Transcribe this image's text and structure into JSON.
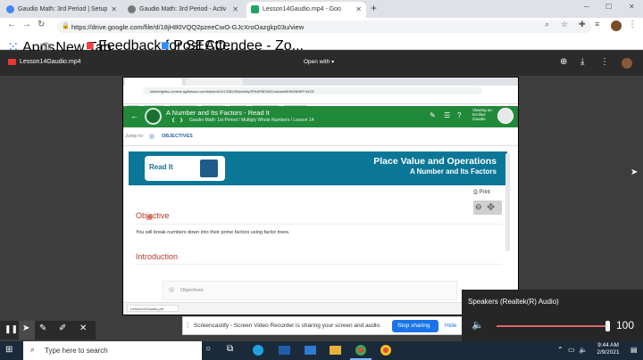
{
  "browser": {
    "tabs": [
      {
        "label": "Gaudio Math: 3rd Period | Setup",
        "color": "#4285f4",
        "active": false
      },
      {
        "label": "Gaudio Math: 3rd Period - Activ",
        "color": "#555555",
        "active": false
      },
      {
        "label": "Lesson14Gaudio.mp4 - Goo",
        "color": "#1fa463",
        "active": true
      }
    ],
    "new_tab": "+",
    "url": "https://drive.google.com/file/d/18jH80VQQ2pzeeCwO-GJcXroOazgkp03u/view",
    "bookmarks": [
      "Apps",
      "New Tab",
      "Feedback for SECO...",
      "Post Attendee - Zo..."
    ]
  },
  "drive": {
    "filename": "Lesson14Gaudio.mp4",
    "open_with": "Open with"
  },
  "lms": {
    "inner_url": "kidsheightsc-central.agilixbuzz.com/student/141338205/activity/5F6AFBD9AD1a4aba5bf9/08b6FFd4CE",
    "title": "A Number and Its Factors - Read It",
    "breadcrumb": "Gaudio Math: 1st Period / Multiply Whole Numbers / Lesson 14",
    "viewing_as": "Viewing as:\nEmiliee\nGaudio",
    "jump_to": "Jump to:",
    "objectives_link": "OBJECTIVES",
    "read_it": "Read It",
    "banner_title": "Place Value and Operations",
    "banner_subtitle": "A Number and Its Factors",
    "print": "Print",
    "objective_heading": "Objective",
    "objective_text": "You will break numbers down into their prime factors using factor trees.",
    "introduction_heading": "Introduction",
    "bottom_objectives": "Objectives",
    "download_file": "Lesson14Gaudio.pdf"
  },
  "screencastify": {
    "message": "Screencastify - Screen Video Recorder is sharing your screen and audio.",
    "stop_label": "Stop sharing",
    "hide_label": "Hide"
  },
  "speaker": {
    "device": "Speakers (Realtek(R) Audio)",
    "volume": "100",
    "volume_level": 1.0
  },
  "taskbar": {
    "search_placeholder": "Type here to search",
    "time": "9:44 AM",
    "date": "2/9/2021"
  }
}
